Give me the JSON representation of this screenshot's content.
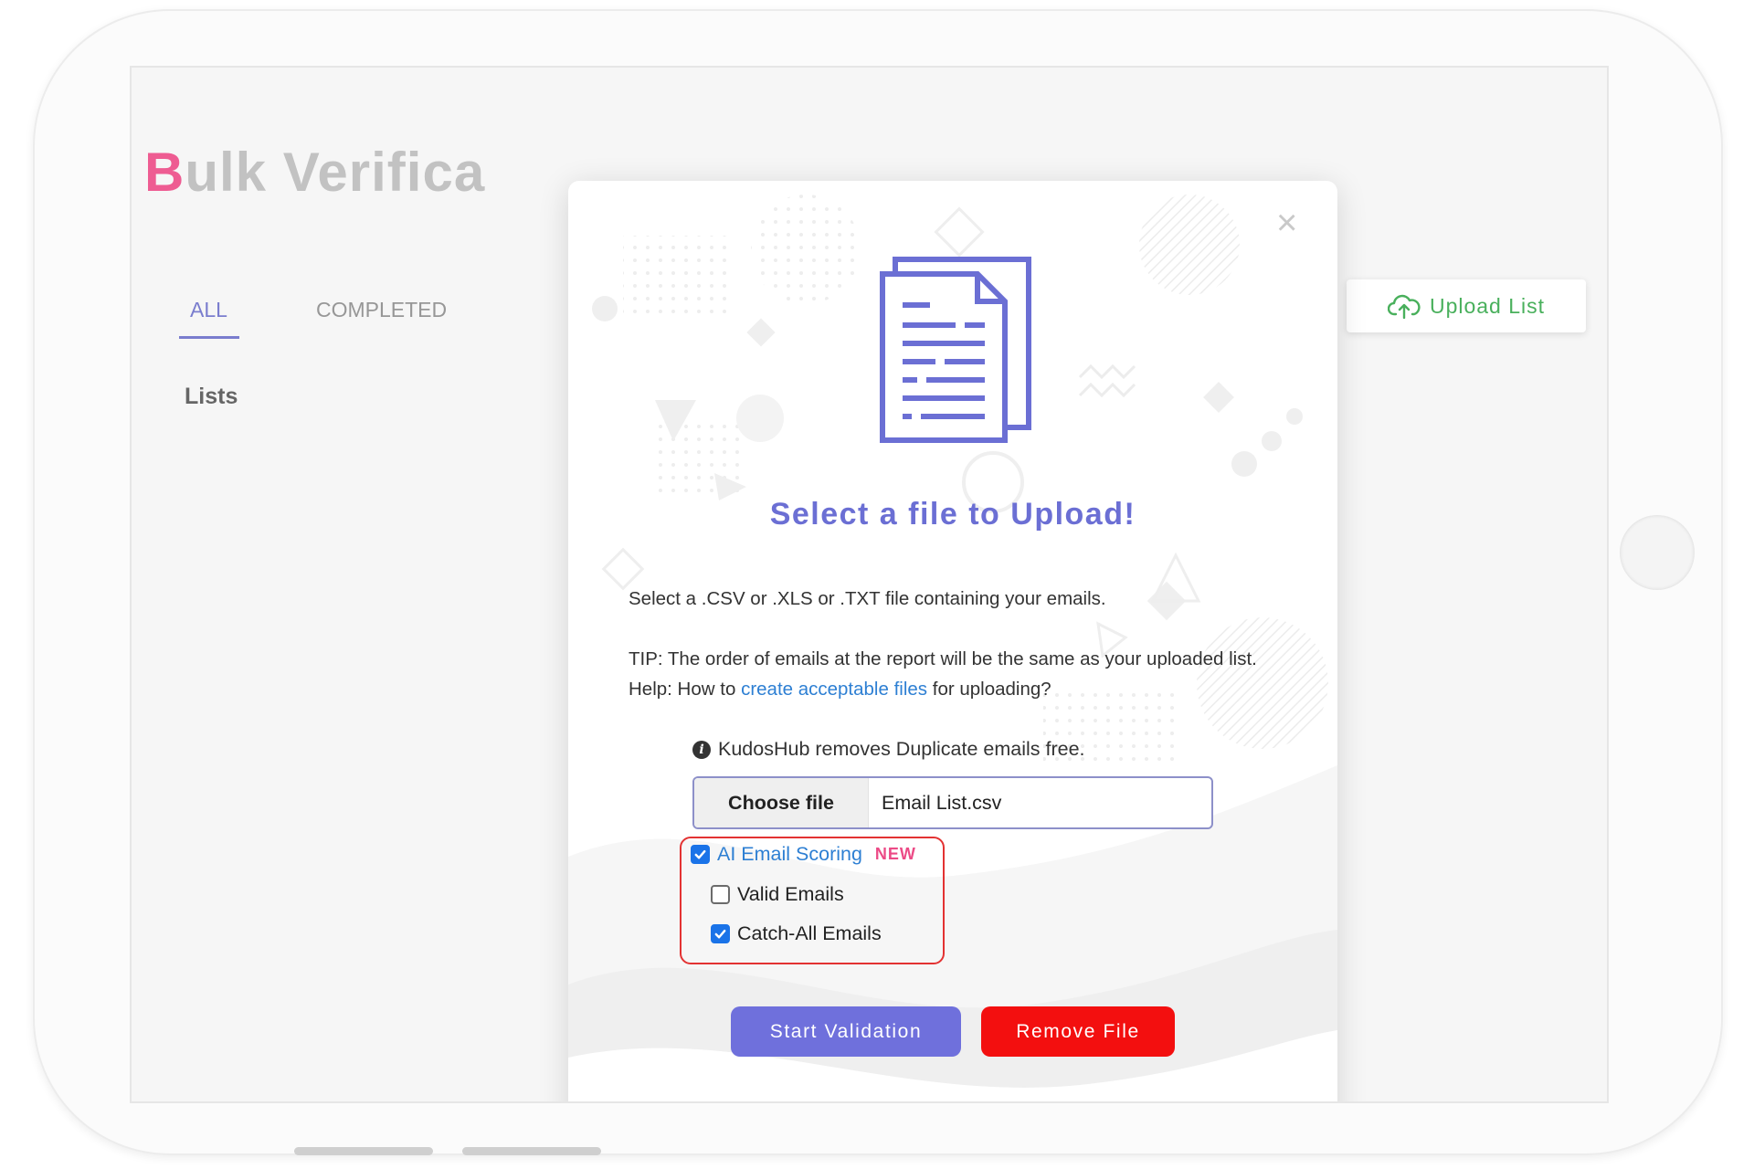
{
  "background_page": {
    "title_first_letter": "B",
    "title_rest": "ulk Verifica",
    "tabs": [
      {
        "label": "ALL",
        "active": true
      },
      {
        "label": "COMPLETED",
        "active": false
      }
    ],
    "section_label": "Lists",
    "upload_button_label": "Upload List"
  },
  "modal": {
    "close_label": "×",
    "title": "Select a file to Upload!",
    "description": "Select a .CSV or .XLS or .TXT file containing your emails.",
    "tip": "TIP: The order of emails at the report will be the same as your uploaded list.",
    "help_prefix": "Help: How to ",
    "help_link": "create acceptable files",
    "help_suffix": " for uploading?",
    "info_icon_glyph": "i",
    "duplicate_note": "KudosHub removes Duplicate emails free.",
    "file_input": {
      "button_label": "Choose file",
      "file_name": "Email List.csv"
    },
    "options": {
      "ai_scoring": {
        "label": "AI Email Scoring",
        "badge": "NEW",
        "checked": true
      },
      "valid_emails": {
        "label": "Valid Emails",
        "checked": false
      },
      "catch_all_emails": {
        "label": "Catch-All Emails",
        "checked": true
      }
    },
    "start_button_label": "Start Validation",
    "remove_button_label": "Remove File"
  },
  "colors": {
    "accent": "#6b6fd4",
    "brand_pink": "#ec4a86",
    "upload_green": "#35a74a",
    "start_button": "#6f70dc",
    "remove_button": "#f30f0f",
    "link": "#2d7fd3",
    "highlight_border": "#e33232"
  },
  "icons": [
    "document-icon",
    "cloud-upload-icon",
    "info-icon",
    "close-icon",
    "checkmark-icon"
  ]
}
